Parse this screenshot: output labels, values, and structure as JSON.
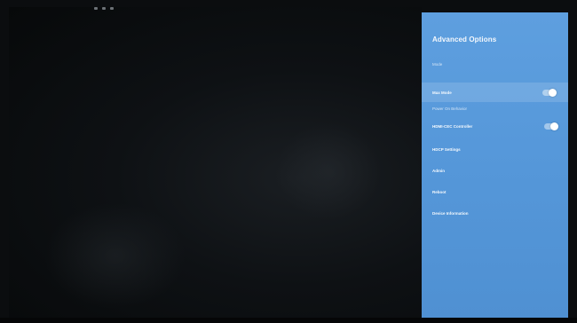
{
  "panel": {
    "title": "Advanced Options",
    "sections": [
      {
        "label": "Mode"
      },
      {
        "label": "Power On Behavior"
      }
    ],
    "items": [
      {
        "label": "Max Mode",
        "toggle": "on"
      },
      {
        "label": "HDMI-CEC Controller",
        "toggle": "on"
      },
      {
        "label": "HDCP Settings"
      },
      {
        "label": "Admin"
      },
      {
        "label": "Reboot"
      },
      {
        "label": "Device Information"
      }
    ]
  },
  "colors": {
    "panel_background": "#5597d9",
    "highlight": "#ffffff"
  }
}
